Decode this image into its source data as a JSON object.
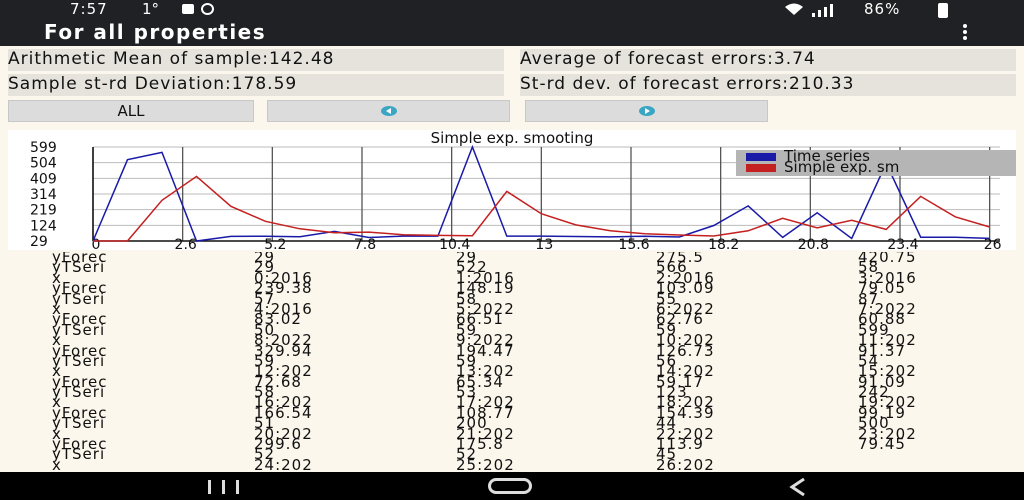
{
  "status": {
    "time": "7:57",
    "temp": "1°",
    "battery": "86%"
  },
  "app": {
    "title": "For all properties"
  },
  "stats": {
    "mean": "Arithmetic Mean of sample:142.48",
    "avg_forecast": "Average of forecast errors:3.74",
    "std": "Sample st-rd Deviation:178.59",
    "std_forecast": "St-rd dev. of forecast errors:210.33"
  },
  "buttons": {
    "all": "ALL"
  },
  "chart_data": {
    "type": "line",
    "title": "Simple exp. smooting",
    "x": [
      0,
      1,
      2,
      3,
      4,
      5,
      6,
      7,
      8,
      9,
      10,
      11,
      12,
      13,
      14,
      15,
      16,
      17,
      18,
      19,
      20,
      21,
      22,
      23,
      24,
      25,
      26
    ],
    "series": [
      {
        "name": "Time series",
        "color": "#1a1aa8",
        "values": [
          29,
          522,
          566,
          29,
          57,
          58,
          55,
          87,
          50,
          59,
          59,
          599,
          59,
          59,
          56,
          54,
          58,
          53,
          123,
          242,
          51,
          200,
          44,
          500,
          52,
          52,
          45
        ]
      },
      {
        "name": "Simple exp. smoothing",
        "color": "#c42020",
        "values": [
          29,
          29,
          275.5,
          420.75,
          239.38,
          148.19,
          103.09,
          79.05,
          83.02,
          66.51,
          62.76,
          60.88,
          329.94,
          194.47,
          126.73,
          91.37,
          72.68,
          65.34,
          59.17,
          91.09,
          166.54,
          108.77,
          154.39,
          99.19,
          299.6,
          175.8,
          113.9
        ]
      }
    ],
    "xticks": [
      "0",
      "2.6",
      "5.2",
      "7.8",
      "10.4",
      "13",
      "15.6",
      "18.2",
      "20.8",
      "23.4",
      "26"
    ],
    "yticks": [
      "599",
      "504",
      "409",
      "314",
      "219",
      "124",
      "29"
    ],
    "legend": [
      "Time series",
      "Simple exp. sm"
    ],
    "legend_position": "top-right",
    "ylim": [
      29,
      599
    ],
    "xlim": [
      0,
      26.3
    ]
  },
  "table": [
    [
      "yForec",
      "29",
      "29",
      "275.5",
      "420.75"
    ],
    [
      "yTSeri",
      "29",
      "522",
      "566",
      "58"
    ],
    [
      "x",
      "0:2016",
      "1:2016",
      "2:2016",
      "3:2016"
    ],
    [
      "yForec",
      "239.38",
      "148.19",
      "103.09",
      "79.05"
    ],
    [
      "yTSeri",
      "57",
      "58",
      "55",
      "87"
    ],
    [
      "x",
      "4:2016",
      "5:2022",
      "6:2022",
      "7:2022"
    ],
    [
      "yForec",
      "83.02",
      "66.51",
      "62.76",
      "60.88"
    ],
    [
      "yTSeri",
      "50",
      "59",
      "59",
      "599"
    ],
    [
      "x",
      "8:2022",
      "9:2022",
      "10:202",
      "11:202"
    ],
    [
      "yForec",
      "329.94",
      "194.47",
      "126.73",
      "91.37"
    ],
    [
      "yTSeri",
      "59",
      "59",
      "56",
      "54"
    ],
    [
      "x",
      "12:202",
      "13:202",
      "14:202",
      "15:202"
    ],
    [
      "yForec",
      "72.68",
      "65.34",
      "59.17",
      "91.09"
    ],
    [
      "yTSeri",
      "58",
      "53",
      "123",
      "242"
    ],
    [
      "x",
      "16:202",
      "17:202",
      "18:202",
      "19:202"
    ],
    [
      "yForec",
      "166.54",
      "108.77",
      "154.39",
      "99.19"
    ],
    [
      "yTSeri",
      "51",
      "200",
      "44",
      "500"
    ],
    [
      "x",
      "20:202",
      "21:202",
      "22:202",
      "23:202"
    ],
    [
      "yForec",
      "299.6",
      "175.8",
      "113.9",
      "79.45"
    ],
    [
      "yTSeri",
      "52",
      "52",
      "45",
      ""
    ],
    [
      "x",
      "24:202",
      "25:202",
      "26:202",
      ""
    ]
  ]
}
